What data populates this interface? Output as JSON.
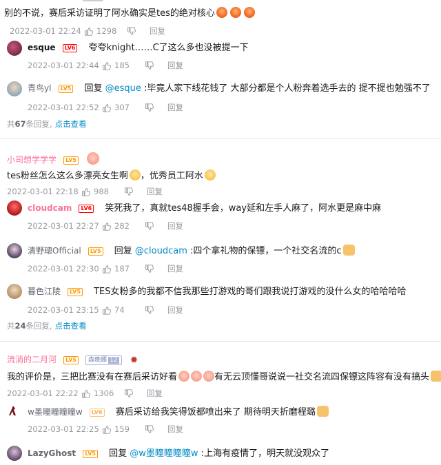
{
  "top_comment": {
    "text": "别的不说，赛后采访证明了阿水确实是tes的绝对核心",
    "time": "2022-03-01 22:24",
    "likes": "1298",
    "reply_label": "回复",
    "replies": [
      {
        "user": "esque",
        "level": "LV6",
        "text": "夸夸knight……C了这么多也没被提一下",
        "time": "2022-03-01 22:44",
        "likes": "185",
        "reply_label": "回复"
      },
      {
        "user": "青鸟yl",
        "level": "LV5",
        "prefix": "回复",
        "mention": "@esque",
        "text": ":毕竟人家下线花钱了 大部分都是个人粉奔着选手去的 提不提也勉强不了",
        "time": "2022-03-01 22:52",
        "likes": "307",
        "reply_label": "回复"
      }
    ],
    "more": {
      "pre": "共",
      "count": "67",
      "post": "条回复,",
      "link": "点击查看"
    }
  },
  "comment2": {
    "user": "小司想学学学",
    "level": "LV5",
    "text": "tes粉丝怎么这么多漂亮女生啊",
    "text2": "，优秀员工阿水",
    "time": "2022-03-01 22:18",
    "likes": "988",
    "reply_label": "回复",
    "replies": [
      {
        "user": "cloudcam",
        "level": "LV6",
        "text": "笑死我了，真就tes48握手会，way延和左手人麻了，阿水更是麻中麻",
        "time": "2022-03-01 22:27",
        "likes": "282",
        "reply_label": "回复"
      },
      {
        "user": "清野璁Official",
        "level": "LV5",
        "prefix": "回复",
        "mention": "@cloudcam",
        "text": ":四个拿礼物的保镖，一个社交名流的c",
        "time": "2022-03-01 22:30",
        "likes": "187",
        "reply_label": "回复"
      },
      {
        "user": "暮色江陵",
        "level": "LV5",
        "text": "TES女粉多的我都不信我那些打游戏的哥们跟我说打游戏的没什么女的哈哈哈哈",
        "time": "2022-03-01 23:15",
        "likes": "74",
        "reply_label": "回复"
      }
    ],
    "more": {
      "pre": "共",
      "count": "24",
      "post": "条回复,",
      "link": "点击查看"
    }
  },
  "comment3": {
    "user": "流淌的二月河",
    "level": "LV5",
    "fan_badge": "森晚娜",
    "fan_level": "12",
    "text": "我的评价是，三把比赛没有在赛后采访好看",
    "text2": "有无云顶懂哥说说一社交名流四保镖这阵容有没有搞头",
    "time": "2022-03-01 22:22",
    "likes": "1306",
    "reply_label": "回复",
    "replies": [
      {
        "user": "w墨瞳瞳瞳瞳w",
        "level": "LV6",
        "text": "赛后采访给我笑得饭都喷出来了  期待明天折磨程璐",
        "time": "2022-03-01 22:25",
        "likes": "159",
        "reply_label": "回复"
      },
      {
        "user": "LazyGhost",
        "level": "LV5",
        "prefix": "回复",
        "mention": "@w墨瞳瞳瞳瞳w",
        "text": ":上海有疫情了，明天就没观众了"
      }
    ]
  },
  "icons": {
    "like": "thumb-up-icon",
    "dislike": "thumb-down-icon"
  },
  "colors": {
    "link": "#008ac5",
    "username_pink": "#fb7299",
    "meta": "#9499a0",
    "lv6": "#ff0000",
    "lv5": "#ff9900"
  }
}
